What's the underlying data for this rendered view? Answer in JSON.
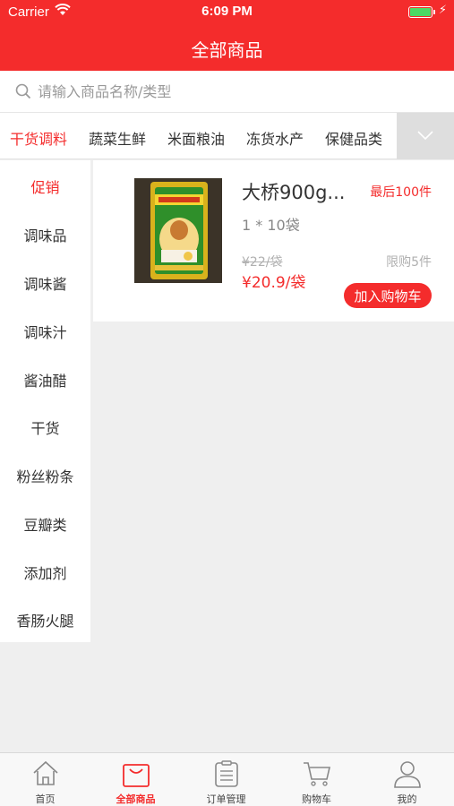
{
  "status_bar": {
    "carrier": "Carrier",
    "time": "6:09 PM",
    "battery_color": "#4cd964"
  },
  "header": {
    "title": "全部商品",
    "bg_color": "#f42c2c"
  },
  "search": {
    "placeholder": "请输入商品名称/类型",
    "value": "",
    "icon": "search-icon"
  },
  "categories": {
    "items": [
      "干货调料",
      "蔬菜生鲜",
      "米面粮油",
      "冻货水产",
      "保健品类"
    ],
    "active": "干货调料",
    "more_icon": "chevron-down-icon"
  },
  "sidebar": {
    "items": [
      "促销",
      "调味品",
      "调味酱",
      "调味汁",
      "酱油醋",
      "干货",
      "粉丝粉条",
      "豆瓣类",
      "添加剂",
      "香肠火腿"
    ],
    "active": "促销"
  },
  "product": {
    "name": "大桥900g...",
    "badge": "最后100件",
    "spec": "1 * 10袋",
    "old_price": "¥22/袋",
    "limit": "限购5件",
    "price": "¥20.9/袋",
    "add_button": "加入购物车"
  },
  "tabbar": {
    "items": [
      {
        "label": "首页",
        "icon": "home-icon"
      },
      {
        "label": "全部商品",
        "icon": "shopping-bag-icon"
      },
      {
        "label": "订单管理",
        "icon": "order-list-icon"
      },
      {
        "label": "购物车",
        "icon": "cart-icon"
      },
      {
        "label": "我的",
        "icon": "user-icon"
      }
    ],
    "active": "全部商品"
  },
  "colors": {
    "accent": "#f42c2c",
    "background": "#efefef"
  }
}
